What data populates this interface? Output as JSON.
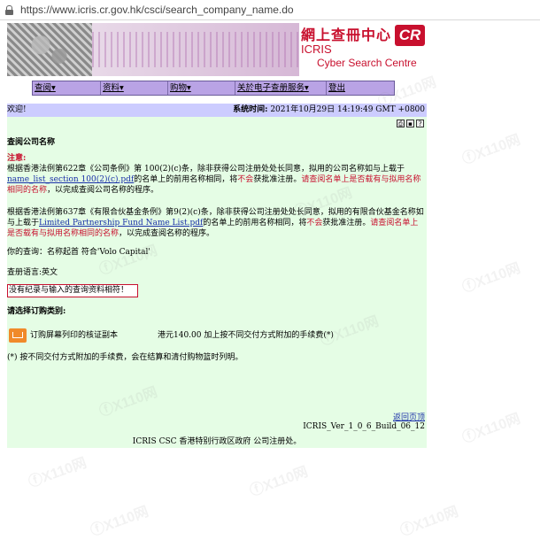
{
  "browser": {
    "url": "https://www.icris.cr.gov.hk/csci/search_company_name.do"
  },
  "banner": {
    "title_cn": "網上查冊中心",
    "logo_text": "CR",
    "brand": "ICRIS",
    "subtitle": "Cyber Search Centre"
  },
  "menu": {
    "items": [
      "查阅▾",
      "资料▾",
      "购物▾",
      "关於电子查册服务▾",
      "登出"
    ]
  },
  "content": {
    "welcome": "欢迎!",
    "systime_label": "系统时间:",
    "systime_value": "2021年10月29日 14:19:49 GMT +0800",
    "section_title": "查阅公司名称",
    "note_label": "注意:",
    "para1_a": "根据香港法例第622章《公司条例》第 100(2)(c)条，除非获得公司注册处处长同意，拟用的公司名称如与上载于",
    "para1_link": "name_list_section 100(2)(c).pdf",
    "para1_b": "的名单上的前用名称相同，将",
    "para1_notword": "不会",
    "para1_c": "获批准注册。",
    "para1_red": "请查阅名单上是否载有与拟用名称相同的名称",
    "para1_d": "，以完成查阅公司名称的程序。",
    "para2_a": "根据香港法例第637章《有限合伙基金条例》第9(2)(c)条，除非获得公司注册处处长同意，拟用的有限合伙基金名称如与上载于",
    "para2_link": "Limited Partnership Fund Name List.pdf",
    "para2_b": "的名单上的前用名称相同，将",
    "para2_notword": "不会",
    "para2_c": "获批准注册。",
    "para2_red": "请查阅名单上是否载有与拟用名称相同的名称",
    "para2_d": "，以完成查阅名称的程序。",
    "query_label": "你的查询：",
    "query_value": "名称起首 符合'Volo Capital'",
    "lang_label": "查册语言:",
    "lang_value": "英文",
    "no_record": "没有纪录与输入的查询资料相符！",
    "order_title": "请选择订购类别:",
    "order_item": "订购屏幕列印的核证副本",
    "order_price": "港元140.00 加上按不同交付方式附加的手续费(*)",
    "footnote": "(*) 按不同交付方式附加的手续费，会在结算和清付购物篮时列明。",
    "back_link": "返回页顶",
    "version": "ICRIS_Ver_1_0_6_Build_06_12",
    "footer": "ICRIS CSC 香港特别行政区政府 公司注册处。"
  },
  "watermark": "ⓕX110网"
}
